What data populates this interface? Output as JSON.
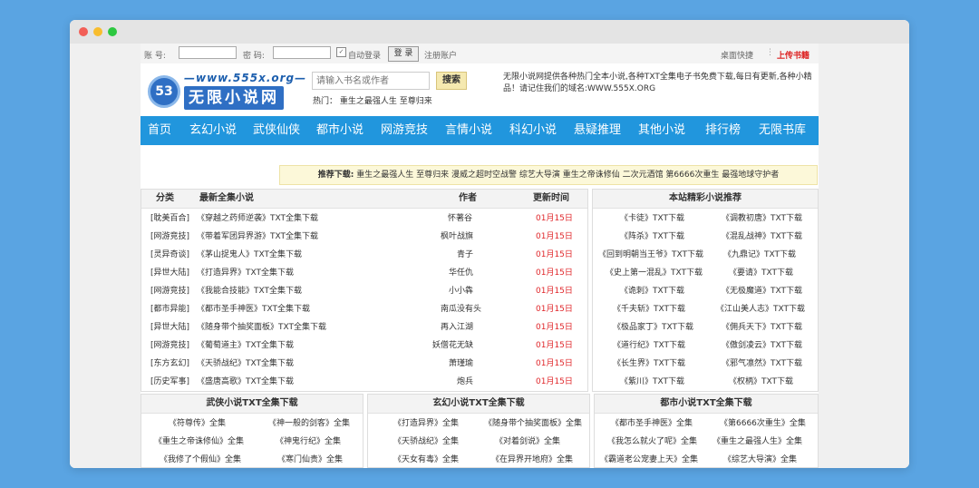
{
  "login": {
    "account_label": "账 号:",
    "password_label": "密 码:",
    "auto_login": "自动登录",
    "login_button": "登 录",
    "register": "注册账户",
    "desktop_shortcut": "桌面快捷",
    "separator": "⋮",
    "upload_books": "上传书籍"
  },
  "header": {
    "logo_url": "—www.555x.org—",
    "logo_name": "无限小说网",
    "logo_badge": "53",
    "search_placeholder": "请输入书名或作者",
    "search_button": "搜索",
    "hot_label": "热门：",
    "hot_items": "重生之最强人生  至尊归来",
    "intro": "无限小说网提供各种热门全本小说,各种TXT全集电子书免费下载,每日有更新,各种小精品！请记住我们的域名:WWW.555X.ORG"
  },
  "nav": [
    "首页",
    "玄幻小说",
    "武侠仙侠",
    "都市小说",
    "网游竞技",
    "言情小说",
    "科幻小说",
    "悬疑推理",
    "其他小说",
    "排行榜",
    "无限书库"
  ],
  "recommend": {
    "label": "推荐下载:",
    "items": "重生之最强人生 至尊归来 漫威之超时空战警 综艺大导演 重生之帝诛修仙 二次元酒馆 第6666次重生 最强地球守护者"
  },
  "latest": {
    "headers": {
      "category": "分类",
      "title": "最新全集小说",
      "author": "作者",
      "updated": "更新时间"
    },
    "rows": [
      {
        "category": "[耽美百合]",
        "title": "《穿越之药师逆袭》TXT全集下载",
        "author": "怀著谷",
        "date": "01月15日"
      },
      {
        "category": "[网游竞技]",
        "title": "《带着军团异界游》TXT全集下载",
        "author": "枫叶战旗",
        "date": "01月15日"
      },
      {
        "category": "[灵异奇谈]",
        "title": "《茅山捉鬼人》TXT全集下载",
        "author": "青子",
        "date": "01月15日"
      },
      {
        "category": "[异世大陆]",
        "title": "《打造异界》TXT全集下载",
        "author": "华任仇",
        "date": "01月15日"
      },
      {
        "category": "[网游竞技]",
        "title": "《我能合技能》TXT全集下载",
        "author": "小小犇",
        "date": "01月15日"
      },
      {
        "category": "[都市异能]",
        "title": "《都市圣手神医》TXT全集下载",
        "author": "南瓜没有头",
        "date": "01月15日"
      },
      {
        "category": "[异世大陆]",
        "title": "《随身带个抽奖面板》TXT全集下载",
        "author": "再入江湖",
        "date": "01月15日"
      },
      {
        "category": "[网游竞技]",
        "title": "《葡萄道主》TXT全集下载",
        "author": "妖僧花无缺",
        "date": "01月15日"
      },
      {
        "category": "[东方玄幻]",
        "title": "《天骄战纪》TXT全集下载",
        "author": "萧瑾瑜",
        "date": "01月15日"
      },
      {
        "category": "[历史军事]",
        "title": "《盛唐高歌》TXT全集下载",
        "author": "炮兵",
        "date": "01月15日"
      }
    ]
  },
  "recommended": {
    "title": "本站精彩小说推荐",
    "rows": [
      [
        "《卡徒》TXT下载",
        "《调教初唐》TXT下载"
      ],
      [
        "《阵杀》TXT下载",
        "《混乱战神》TXT下载"
      ],
      [
        "《回到明朝当王爷》TXT下载",
        "《九鼎记》TXT下载"
      ],
      [
        "《史上第一混乱》TXT下载",
        "《要请》TXT下载"
      ],
      [
        "《诡刺》TXT下载",
        "《无极魔道》TXT下载"
      ],
      [
        "《千夫斩》TXT下载",
        "《江山美人志》TXT下载"
      ],
      [
        "《极品家丁》TXT下载",
        "《佣兵天下》TXT下载"
      ],
      [
        "《道行纪》TXT下载",
        "《傲剑凌云》TXT下载"
      ],
      [
        "《长生界》TXT下载",
        "《邪气凛然》TXT下载"
      ],
      [
        "《紫川》TXT下载",
        "《权柄》TXT下载"
      ]
    ]
  },
  "sections": [
    {
      "title": "武侠小说TXT全集下载",
      "rows": [
        [
          "《符尊传》全集",
          "《神一般的剑客》全集"
        ],
        [
          "《重生之帝诛修仙》全集",
          "《神鬼行纪》全集"
        ],
        [
          "《我修了个假仙》全集",
          "《寒门仙贵》全集"
        ]
      ]
    },
    {
      "title": "玄幻小说TXT全集下载",
      "rows": [
        [
          "《打造异界》全集",
          "《随身带个抽奖面板》全集"
        ],
        [
          "《天骄战纪》全集",
          "《对着剑说》全集"
        ],
        [
          "《天女有毒》全集",
          "《在异界开地府》全集"
        ]
      ]
    },
    {
      "title": "都市小说TXT全集下载",
      "rows": [
        [
          "《都市圣手神医》全集",
          "《第6666次重生》全集"
        ],
        [
          "《我怎么就火了呢》全集",
          "《重生之最强人生》全集"
        ],
        [
          "《霸道老公宠妻上天》全集",
          "《综艺大导演》全集"
        ]
      ]
    }
  ]
}
